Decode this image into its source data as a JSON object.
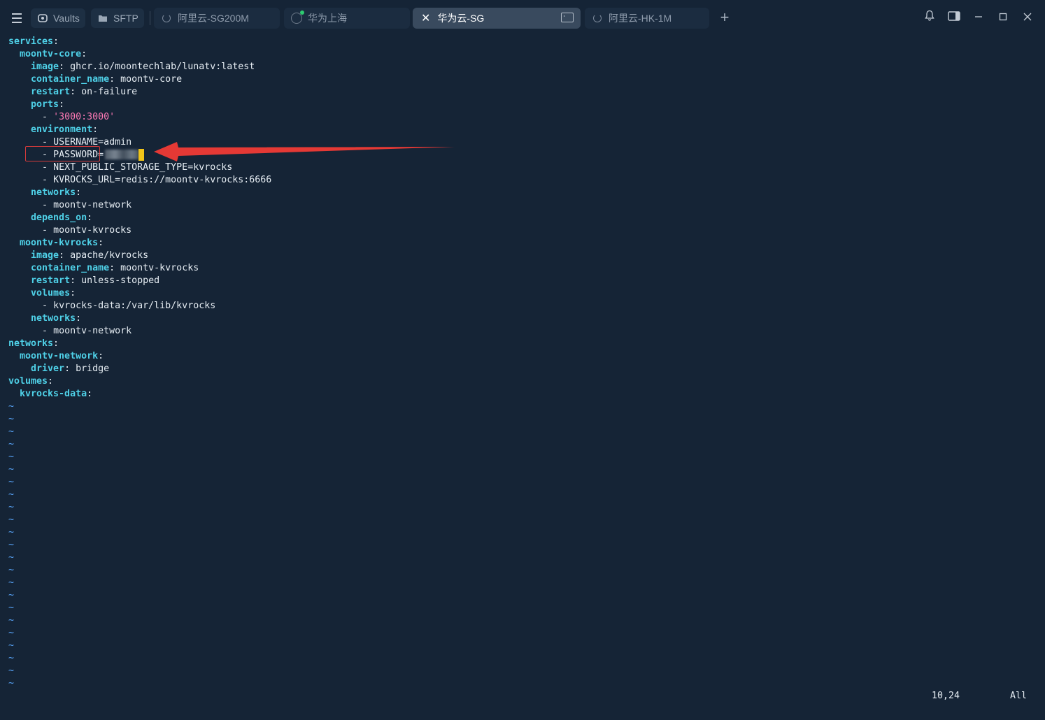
{
  "topbar": {
    "vaults_label": "Vaults",
    "sftp_label": "SFTP"
  },
  "tabs": [
    {
      "label": "阿里云-SG200M"
    },
    {
      "label": "华为上海"
    },
    {
      "label": "华为云-SG"
    },
    {
      "label": "阿里云-HK-1M"
    }
  ],
  "editor": {
    "lines": [
      {
        "indent": "",
        "key": "services",
        "value": ""
      },
      {
        "indent": "  ",
        "key": "moontv-core",
        "value": ""
      },
      {
        "indent": "    ",
        "key": "image",
        "value": " ghcr.io/moontechlab/lunatv:latest"
      },
      {
        "indent": "    ",
        "key": "container_name",
        "value": " moontv-core"
      },
      {
        "indent": "    ",
        "key": "restart",
        "value": " on-failure"
      },
      {
        "indent": "    ",
        "key": "ports",
        "value": ""
      },
      {
        "indent": "      ",
        "item": "'3000:3000'"
      },
      {
        "indent": "    ",
        "key": "environment",
        "value": ""
      },
      {
        "indent": "      ",
        "item": "USERNAME=admin"
      },
      {
        "indent": "      ",
        "item": "PASSWORD="
      },
      {
        "indent": "      ",
        "item": "NEXT_PUBLIC_STORAGE_TYPE=kvrocks"
      },
      {
        "indent": "      ",
        "item": "KVROCKS_URL=redis://moontv-kvrocks:6666"
      },
      {
        "indent": "    ",
        "key": "networks",
        "value": ""
      },
      {
        "indent": "      ",
        "item": "moontv-network"
      },
      {
        "indent": "    ",
        "key": "depends_on",
        "value": ""
      },
      {
        "indent": "      ",
        "item": "moontv-kvrocks"
      },
      {
        "indent": "  ",
        "key": "moontv-kvrocks",
        "value": ""
      },
      {
        "indent": "    ",
        "key": "image",
        "value": " apache/kvrocks"
      },
      {
        "indent": "    ",
        "key": "container_name",
        "value": " moontv-kvrocks"
      },
      {
        "indent": "    ",
        "key": "restart",
        "value": " unless-stopped"
      },
      {
        "indent": "    ",
        "key": "volumes",
        "value": ""
      },
      {
        "indent": "      ",
        "item": "kvrocks-data:/var/lib/kvrocks"
      },
      {
        "indent": "    ",
        "key": "networks",
        "value": ""
      },
      {
        "indent": "      ",
        "item": "moontv-network"
      },
      {
        "indent": "",
        "key": "networks",
        "value": ""
      },
      {
        "indent": "  ",
        "key": "moontv-network",
        "value": ""
      },
      {
        "indent": "    ",
        "key": "driver",
        "value": " bridge"
      },
      {
        "indent": "",
        "key": "volumes",
        "value": ""
      },
      {
        "indent": "  ",
        "key": "kvrocks-data",
        "value": ""
      }
    ],
    "tilde_count": 23
  },
  "status": {
    "position": "10,24",
    "scroll": "All"
  },
  "colors": {
    "background": "#152436",
    "key": "#4fd1e8",
    "string": "#ff7ab6",
    "annotation": "#e53935",
    "cursor": "#f0c419"
  }
}
